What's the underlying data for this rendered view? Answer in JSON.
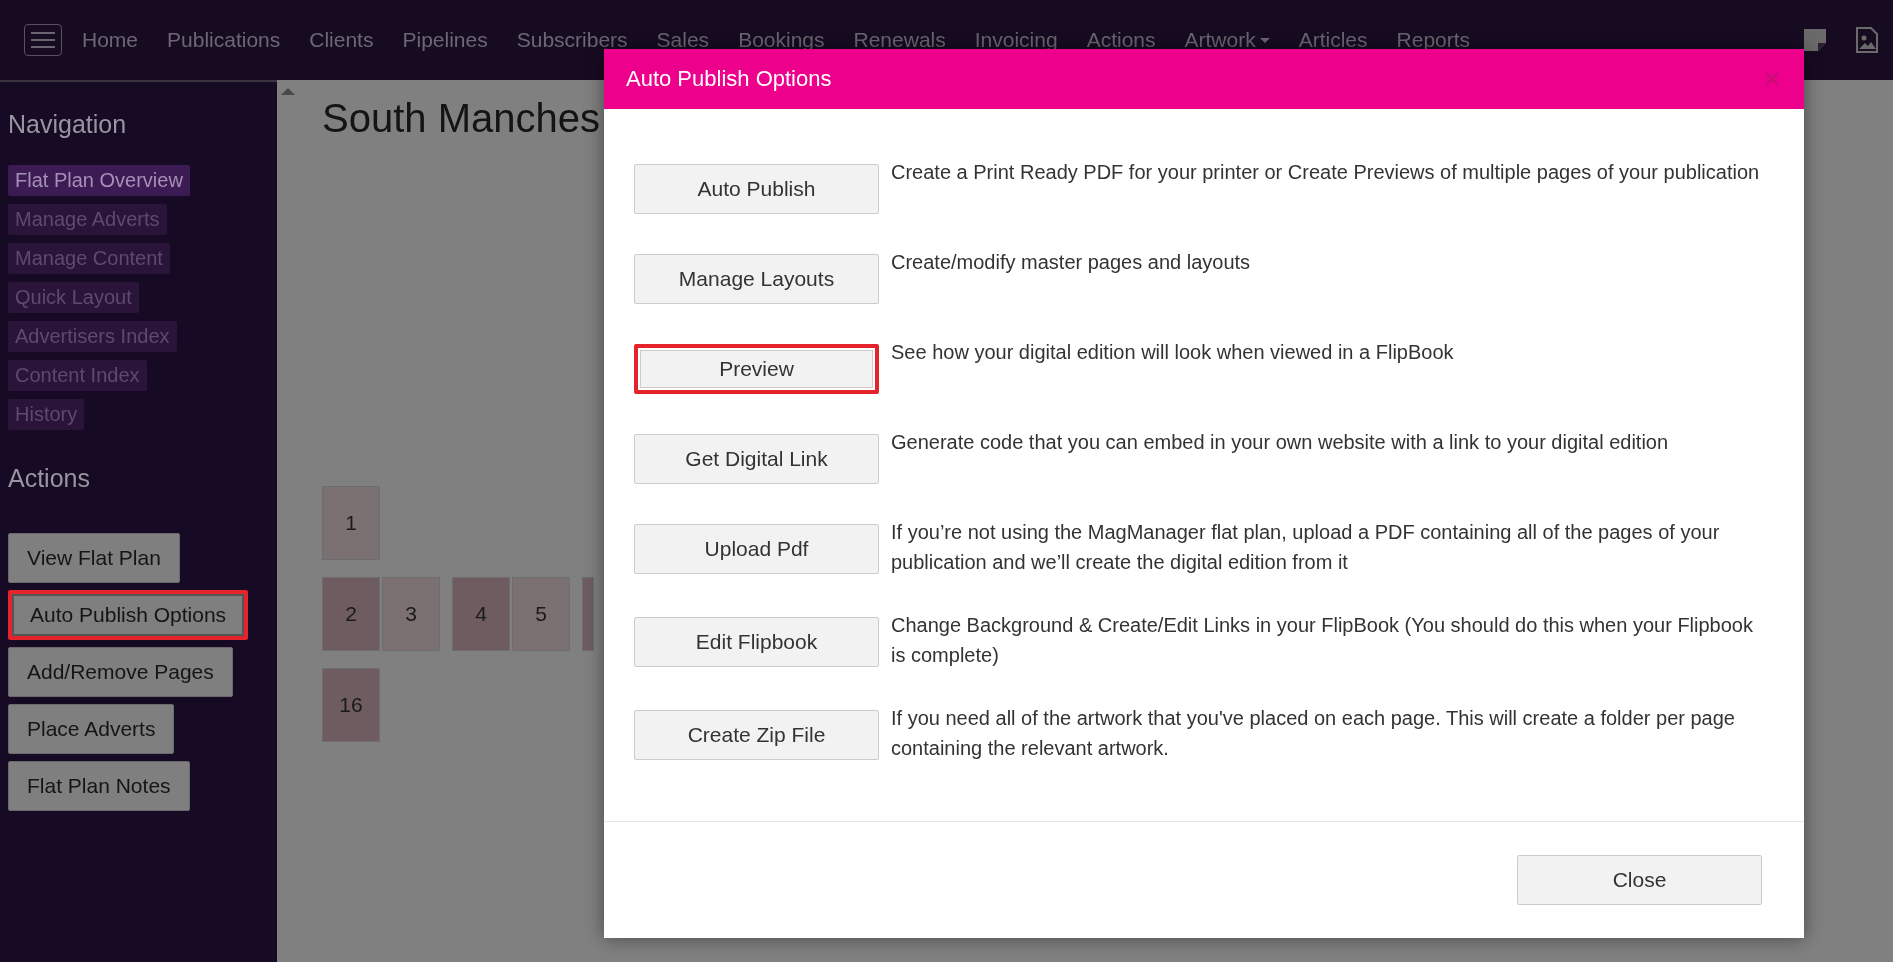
{
  "top_nav": {
    "items": [
      {
        "label": "Home",
        "dropdown": false
      },
      {
        "label": "Publications",
        "dropdown": false
      },
      {
        "label": "Clients",
        "dropdown": false
      },
      {
        "label": "Pipelines",
        "dropdown": false
      },
      {
        "label": "Subscribers",
        "dropdown": false
      },
      {
        "label": "Sales",
        "dropdown": false
      },
      {
        "label": "Bookings",
        "dropdown": false
      },
      {
        "label": "Renewals",
        "dropdown": false
      },
      {
        "label": "Invoicing",
        "dropdown": false
      },
      {
        "label": "Actions",
        "dropdown": false
      },
      {
        "label": "Artwork",
        "dropdown": true
      },
      {
        "label": "Articles",
        "dropdown": false
      },
      {
        "label": "Reports",
        "dropdown": false
      }
    ]
  },
  "sidebar": {
    "navigation": {
      "heading": "Navigation",
      "items": [
        {
          "label": "Flat Plan Overview",
          "selected": true
        },
        {
          "label": "Manage Adverts",
          "selected": false
        },
        {
          "label": "Manage Content",
          "selected": false
        },
        {
          "label": "Quick Layout",
          "selected": false
        },
        {
          "label": "Advertisers Index",
          "selected": false
        },
        {
          "label": "Content Index",
          "selected": false
        },
        {
          "label": "History",
          "selected": false
        }
      ]
    },
    "actions": {
      "heading": "Actions",
      "buttons": [
        {
          "label": "View Flat Plan",
          "highlighted": false
        },
        {
          "label": "Auto Publish Options",
          "highlighted": true
        },
        {
          "label": "Add/Remove Pages",
          "highlighted": false
        },
        {
          "label": "Place Adverts",
          "highlighted": false
        },
        {
          "label": "Flat Plan Notes",
          "highlighted": false
        }
      ]
    }
  },
  "page": {
    "title": "South Manches",
    "rows": [
      [
        [
          {
            "label": "1",
            "color": "#7b7173"
          }
        ]
      ],
      [
        [
          {
            "label": "2",
            "color": "#6e5c60"
          },
          {
            "label": "3",
            "color": "#7b7173"
          }
        ],
        [
          {
            "label": "4",
            "color": "#6e5c60"
          },
          {
            "label": "5",
            "color": "#7b7173"
          }
        ],
        [
          {
            "color": "#6e5c60"
          }
        ]
      ],
      [
        [
          {
            "label": "16",
            "color": "#6e5c60"
          }
        ]
      ]
    ]
  },
  "modal": {
    "title": "Auto Publish Options",
    "close_icon": "×",
    "options": [
      {
        "button": "Auto Publish",
        "description": "Create a Print Ready PDF for your printer or Create Previews of multiple pages of your publication",
        "highlighted": false
      },
      {
        "button": "Manage Layouts",
        "description": "Create/modify master pages and layouts",
        "highlighted": false
      },
      {
        "button": "Preview",
        "description": "See how your digital edition will look when viewed in a FlipBook",
        "highlighted": true
      },
      {
        "button": "Get Digital Link",
        "description": "Generate code that you can embed in your own website with a link to your digital edition",
        "highlighted": false
      },
      {
        "button": "Upload Pdf",
        "description": "If you’re not using the MagManager flat plan, upload a PDF containing all of the pages of your publication and we’ll create the digital edition from it",
        "highlighted": false
      },
      {
        "button": "Edit Flipbook",
        "description": "Change Background & Create/Edit Links in your FlipBook (You should do this when your Flipbook is complete)",
        "highlighted": false
      },
      {
        "button": "Create Zip File",
        "description": "If you need all of the artwork that you've placed on each page. This will create a folder per page containing the relevant artwork.",
        "highlighted": false
      }
    ],
    "close_button": "Close"
  }
}
